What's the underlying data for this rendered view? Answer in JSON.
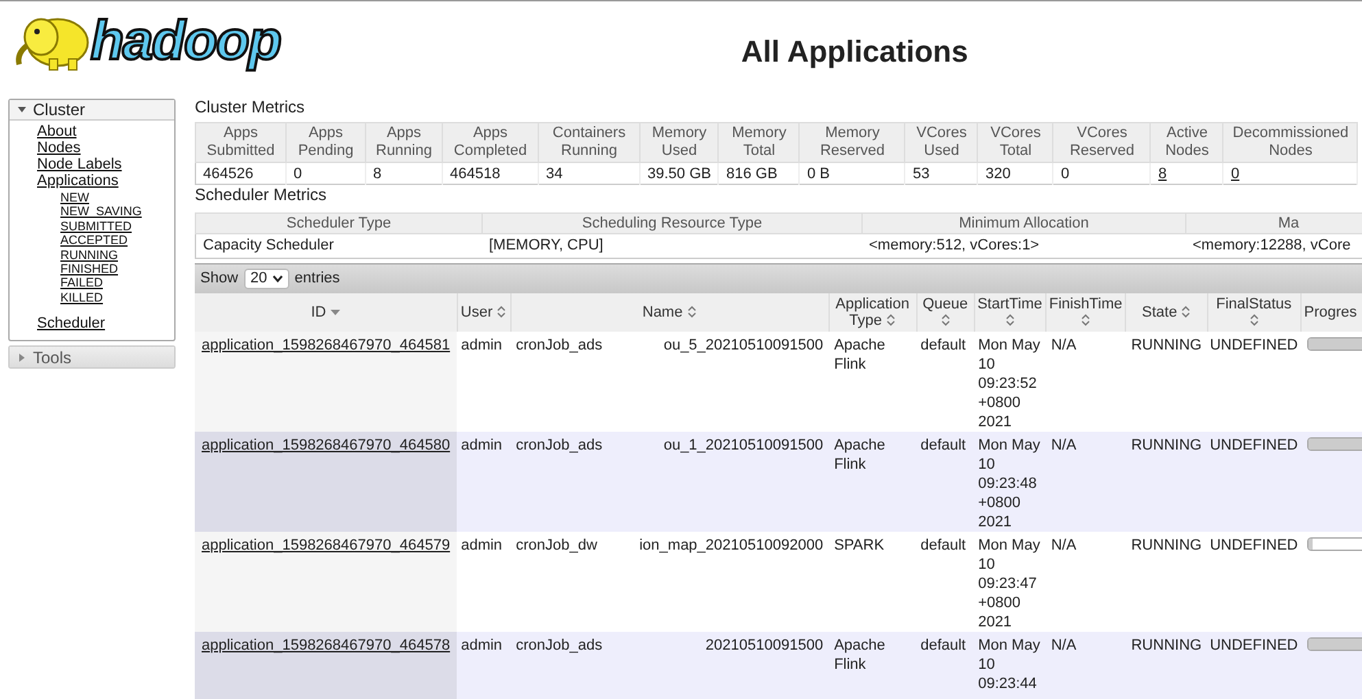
{
  "logo": {
    "text": "hadoop"
  },
  "page_title": "All Applications",
  "sidebar": {
    "sections": [
      {
        "title": "Cluster",
        "expanded": true,
        "items": [
          {
            "label": "About"
          },
          {
            "label": "Nodes"
          },
          {
            "label": "Node Labels"
          },
          {
            "label": "Applications",
            "children": [
              {
                "label": "NEW"
              },
              {
                "label": "NEW_SAVING"
              },
              {
                "label": "SUBMITTED"
              },
              {
                "label": "ACCEPTED"
              },
              {
                "label": "RUNNING"
              },
              {
                "label": "FINISHED"
              },
              {
                "label": "FAILED"
              },
              {
                "label": "KILLED"
              }
            ]
          },
          {
            "label": "Scheduler"
          }
        ]
      },
      {
        "title": "Tools",
        "expanded": false
      }
    ]
  },
  "cluster_metrics": {
    "title": "Cluster Metrics",
    "columns": [
      [
        "Apps",
        "Submitted"
      ],
      [
        "Apps",
        "Pending"
      ],
      [
        "Apps",
        "Running"
      ],
      [
        "Apps",
        "Completed"
      ],
      [
        "Containers",
        "Running"
      ],
      [
        "Memory",
        "Used"
      ],
      [
        "Memory",
        "Total"
      ],
      [
        "Memory",
        "Reserved"
      ],
      [
        "VCores",
        "Used"
      ],
      [
        "VCores",
        "Total"
      ],
      [
        "VCores",
        "Reserved"
      ],
      [
        "Active",
        "Nodes"
      ],
      [
        "Decommissioned",
        "Nodes"
      ]
    ],
    "values": [
      {
        "text": "464526",
        "link": false
      },
      {
        "text": "0",
        "link": false
      },
      {
        "text": "8",
        "link": false
      },
      {
        "text": "464518",
        "link": false
      },
      {
        "text": "34",
        "link": false
      },
      {
        "text": "39.50 GB",
        "link": false
      },
      {
        "text": "816 GB",
        "link": false
      },
      {
        "text": "0 B",
        "link": false
      },
      {
        "text": "53",
        "link": false
      },
      {
        "text": "320",
        "link": false
      },
      {
        "text": "0",
        "link": false
      },
      {
        "text": "8",
        "link": true
      },
      {
        "text": "0",
        "link": true
      }
    ]
  },
  "scheduler_metrics": {
    "title": "Scheduler Metrics",
    "columns": [
      "Scheduler Type",
      "Scheduling Resource Type",
      "Minimum Allocation",
      "Ma"
    ],
    "values": [
      "Capacity Scheduler",
      "[MEMORY, CPU]",
      "<memory:512, vCores:1>",
      "<memory:12288, vCore"
    ]
  },
  "table_controls": {
    "show": "Show",
    "page_size": "20",
    "entries": "entries"
  },
  "apps_table": {
    "columns": [
      {
        "label": "ID",
        "sorted": true
      },
      {
        "label": "User",
        "sorted": false
      },
      {
        "label": "Name",
        "sorted": false
      },
      {
        "label": "Application Type",
        "sorted": false
      },
      {
        "label": "Queue",
        "sorted": false
      },
      {
        "label": "StartTime",
        "sorted": false
      },
      {
        "label": "FinishTime",
        "sorted": false
      },
      {
        "label": "State",
        "sorted": false
      },
      {
        "label": "FinalStatus",
        "sorted": false
      },
      {
        "label": "Progres"
      }
    ],
    "rows": [
      {
        "id": "application_1598268467970_464581",
        "user": "admin",
        "name_start": "cronJob_ads",
        "name_end": "ou_5_20210510091500",
        "type": [
          "Apache",
          "Flink"
        ],
        "queue": "default",
        "start": [
          "Mon May",
          "10",
          "09:23:52",
          "+0800",
          "2021"
        ],
        "finish": "N/A",
        "state": "RUNNING",
        "final_status": "UNDEFINED",
        "level": 1
      },
      {
        "id": "application_1598268467970_464580",
        "user": "admin",
        "name_start": "cronJob_ads",
        "name_end": "ou_1_20210510091500",
        "type": [
          "Apache",
          "Flink"
        ],
        "queue": "default",
        "start": [
          "Mon May",
          "10",
          "09:23:48",
          "+0800",
          "2021"
        ],
        "finish": "N/A",
        "state": "RUNNING",
        "final_status": "UNDEFINED",
        "level": 1
      },
      {
        "id": "application_1598268467970_464579",
        "user": "admin",
        "name_start": "cronJob_dw",
        "name_end": "ion_map_20210510092000",
        "type": [
          "SPARK"
        ],
        "queue": "default",
        "start": [
          "Mon May",
          "10",
          "09:23:47",
          "+0800",
          "2021"
        ],
        "finish": "N/A",
        "state": "RUNNING",
        "final_status": "UNDEFINED",
        "level": 0.05
      },
      {
        "id": "application_1598268467970_464578",
        "user": "admin",
        "name_start": "cronJob_ads",
        "name_end": "20210510091500",
        "type": [
          "Apache",
          "Flink"
        ],
        "queue": "default",
        "start": [
          "Mon May",
          "10",
          "09:23:44"
        ],
        "finish": "N/A",
        "state": "RUNNING",
        "final_status": "UNDEFINED",
        "level": 1
      }
    ]
  }
}
